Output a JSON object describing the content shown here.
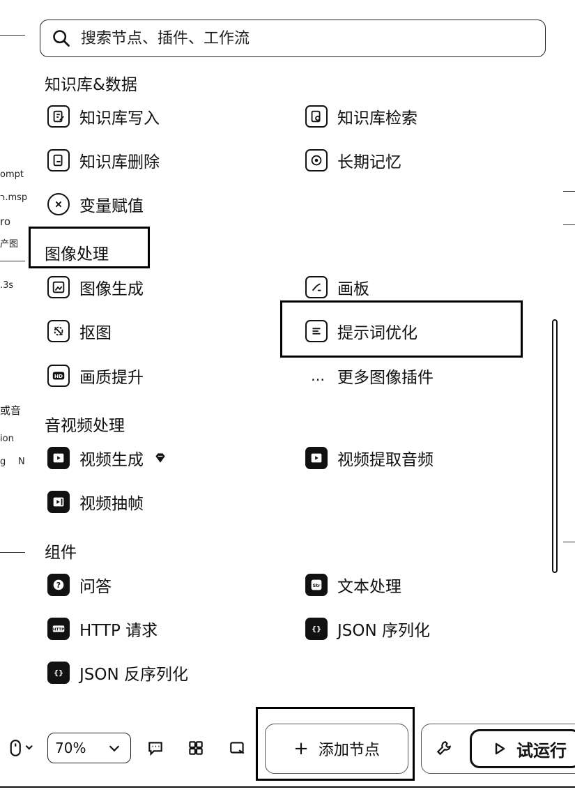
{
  "search": {
    "placeholder": "搜索节点、插件、工作流"
  },
  "sections": {
    "knowledge": {
      "title": "知识库&数据",
      "items": [
        "知识库写入",
        "知识库检索",
        "知识库删除",
        "长期记忆",
        "变量赋值"
      ]
    },
    "image": {
      "title": "图像处理",
      "items": [
        "图像生成",
        "画板",
        "抠图",
        "提示词优化",
        "画质提升"
      ],
      "more": "更多图像插件",
      "more_icon": "…"
    },
    "av": {
      "title": "音视频处理",
      "items": [
        "视频生成",
        "视频提取音频",
        "视频抽帧"
      ],
      "badge_icon": "diamond-icon"
    },
    "components": {
      "title": "组件",
      "items": [
        "问答",
        "文本处理",
        "HTTP 请求",
        "JSON 序列化",
        "JSON 反序列化"
      ]
    }
  },
  "left_fragments": [
    "ompt",
    "ר.msp",
    "ro",
    "产图",
    ".3s",
    "或音",
    "ion",
    "g",
    "N"
  ],
  "toolbar": {
    "zoom": "70%",
    "add_node_plus": "+",
    "add_node": "添加节点",
    "run": "试运行"
  }
}
